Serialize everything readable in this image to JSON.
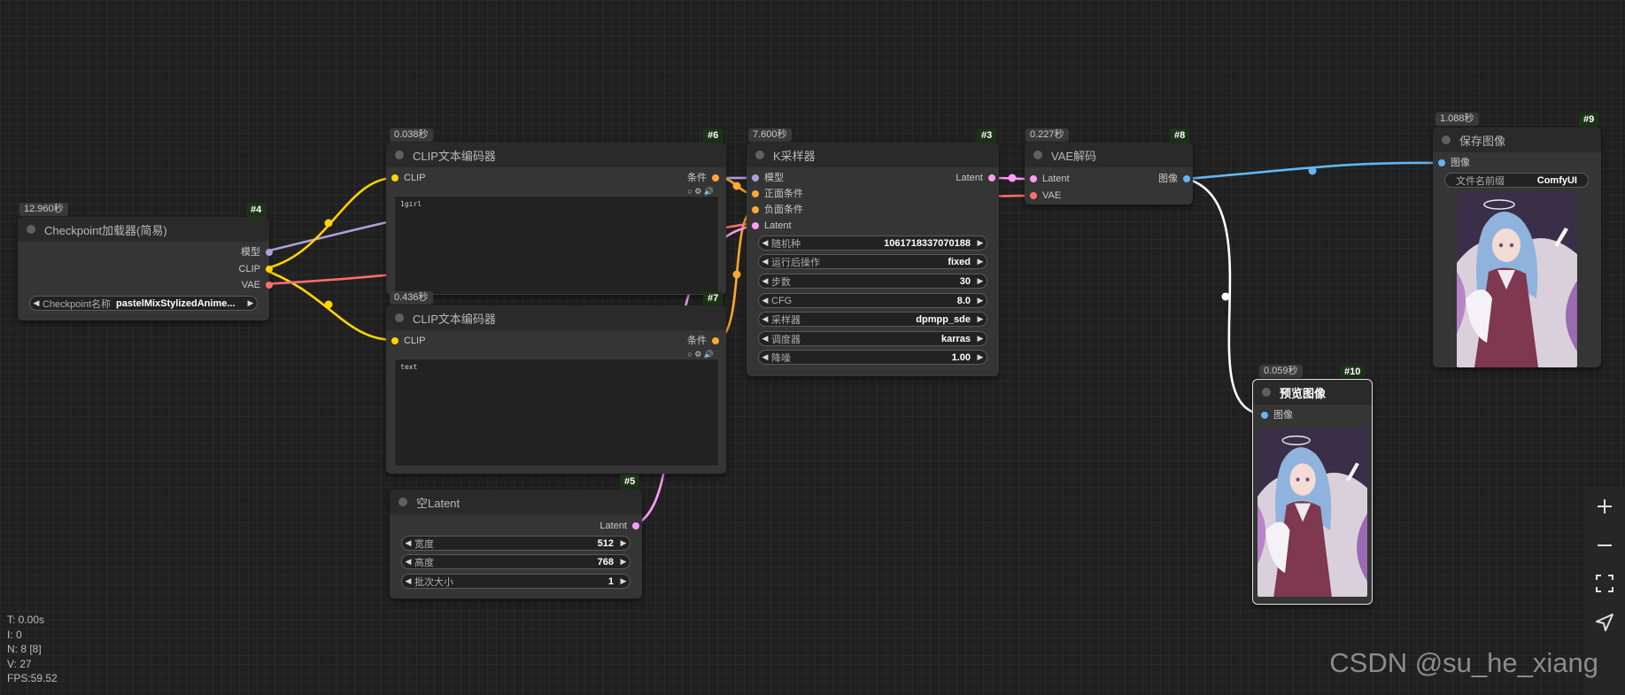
{
  "nodes": {
    "checkpoint": {
      "id": "#4",
      "time": "12.960秒",
      "title": "Checkpoint加载器(简易)",
      "outputs": [
        "模型",
        "CLIP",
        "VAE"
      ],
      "widget": {
        "label": "Checkpoint名称",
        "value": "pastelMixStylizedAnime..."
      }
    },
    "clip_pos": {
      "id": "#6",
      "time": "0.038秒",
      "title": "CLIP文本编码器",
      "input": "CLIP",
      "output": "条件",
      "text": "1girl"
    },
    "clip_neg": {
      "id": "#7",
      "time": "0.436秒",
      "title": "CLIP文本编码器",
      "input": "CLIP",
      "output": "条件",
      "text": "text"
    },
    "latent": {
      "id": "#5",
      "title": "空Latent",
      "output": "Latent",
      "widgets": [
        {
          "label": "宽度",
          "value": "512"
        },
        {
          "label": "高度",
          "value": "768"
        },
        {
          "label": "批次大小",
          "value": "1"
        }
      ]
    },
    "ksampler": {
      "id": "#3",
      "time": "7.600秒",
      "title": "K采样器",
      "inputs": [
        "模型",
        "正面条件",
        "负面条件",
        "Latent"
      ],
      "output": "Latent",
      "widgets": [
        {
          "label": "随机种",
          "value": "1061718337070188"
        },
        {
          "label": "运行后操作",
          "value": "fixed"
        },
        {
          "label": "步数",
          "value": "30"
        },
        {
          "label": "CFG",
          "value": "8.0"
        },
        {
          "label": "采样器",
          "value": "dpmpp_sde"
        },
        {
          "label": "调度器",
          "value": "karras"
        },
        {
          "label": "降噪",
          "value": "1.00"
        }
      ]
    },
    "vae_decode": {
      "id": "#8",
      "time": "0.227秒",
      "title": "VAE解码",
      "inputs": [
        "Latent",
        "VAE"
      ],
      "output": "图像"
    },
    "save_image": {
      "id": "#9",
      "time": "1.088秒",
      "title": "保存图像",
      "input": "图像",
      "widget": {
        "label": "文件名前缀",
        "value": "ComfyUI"
      }
    },
    "preview_image": {
      "id": "#10",
      "time": "0.059秒",
      "title": "预览图像",
      "input": "图像"
    }
  },
  "stats": {
    "t": "T: 0.00s",
    "i": "I: 0",
    "n": "N: 8 [8]",
    "v": "V: 27",
    "fps": "FPS:59.52"
  },
  "watermark": "CSDN @su_he_xiang",
  "colors": {
    "model": "#b39ddb",
    "clip": "#ffd500",
    "vae": "#ff6e6e",
    "conditioning": "#ffa931",
    "latent": "#ff9cf9",
    "image": "#64b5f6"
  },
  "icons": [
    "plus-icon",
    "minus-icon",
    "fit-view-icon",
    "navigate-icon"
  ]
}
